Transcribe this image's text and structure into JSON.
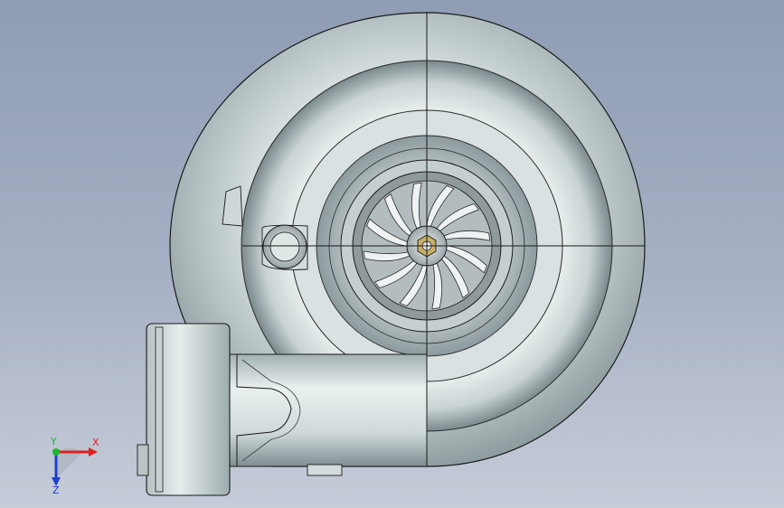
{
  "viewport": {
    "background_top": "#8f9cb3",
    "background_bottom": "#c6ccd8"
  },
  "model": {
    "housing_color": "#dfe6e6",
    "shadow_color": "#6f7f82",
    "edge_color": "#1a1a1a",
    "wheel_color": "#9aa3a6",
    "nut_color": "#b8a15a"
  },
  "triad": {
    "x_label": "X",
    "y_label": "Y",
    "z_label": "Z",
    "x_color": "#e02020",
    "y_color": "#19b82b",
    "z_color": "#1f3fd0"
  }
}
